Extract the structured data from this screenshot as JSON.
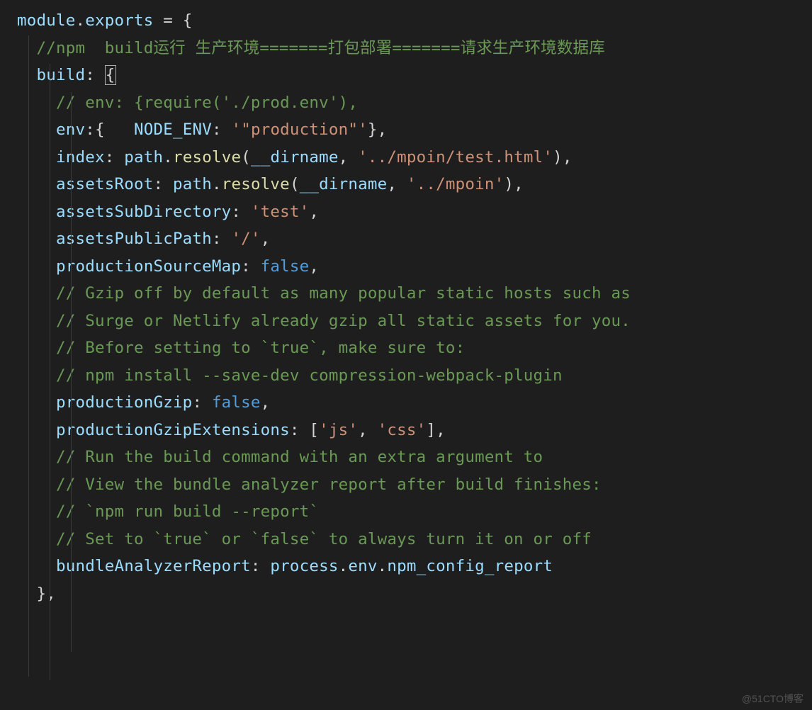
{
  "watermark": "@51CTO博客",
  "code": {
    "l1_module": "module",
    "l1_dot": ".",
    "l1_exports": "exports",
    "l1_eq": " = {",
    "l2_cmt": "  //npm  build运行 生产环境=======打包部署=======请求生产环境数据库",
    "l3_key": "  build",
    "l3_colon": ": ",
    "l3_brace": "{",
    "l4_cmt": "    // env: {require('./prod.env'),",
    "l5_env": "    env",
    "l5_colon": ":{   ",
    "l5_node": "NODE_ENV",
    "l5_colon2": ": ",
    "l5_val": "'\"production\"'",
    "l5_end": "},",
    "l6_k": "    index",
    "l6_c": ": ",
    "l6_path": "path",
    "l6_d": ".",
    "l6_fn": "resolve",
    "l6_o": "(",
    "l6_dir": "__dirname",
    "l6_cm": ", ",
    "l6_s": "'../mpoin/test.html'",
    "l6_cl": "),",
    "l7_k": "    assetsRoot",
    "l7_c": ": ",
    "l7_path": "path",
    "l7_d": ".",
    "l7_fn": "resolve",
    "l7_o": "(",
    "l7_dir": "__dirname",
    "l7_cm": ", ",
    "l7_s": "'../mpoin'",
    "l7_cl": "),",
    "l8_k": "    assetsSubDirectory",
    "l8_c": ": ",
    "l8_s": "'test'",
    "l8_e": ",",
    "l9_k": "    assetsPublicPath",
    "l9_c": ": ",
    "l9_s": "'/'",
    "l9_e": ",",
    "l10_k": "    productionSourceMap",
    "l10_c": ": ",
    "l10_v": "false",
    "l10_e": ",",
    "l11_cmt": "    // Gzip off by default as many popular static hosts such as",
    "l12_cmt": "    // Surge or Netlify already gzip all static assets for you.",
    "l13_cmt": "    // Before setting to `true`, make sure to:",
    "l14_cmt": "    // npm install --save-dev compression-webpack-plugin",
    "l15_k": "    productionGzip",
    "l15_c": ": ",
    "l15_v": "false",
    "l15_e": ",",
    "l16_k": "    productionGzipExtensions",
    "l16_c": ": [",
    "l16_s1": "'js'",
    "l16_cm": ", ",
    "l16_s2": "'css'",
    "l16_e": "],",
    "l17_cmt": "    // Run the build command with an extra argument to",
    "l18_cmt": "    // View the bundle analyzer report after build finishes:",
    "l19_cmt": "    // `npm run build --report`",
    "l20_cmt": "    // Set to `true` or `false` to always turn it on or off",
    "l21_k": "    bundleAnalyzerReport",
    "l21_c": ": ",
    "l21_p1": "process",
    "l21_d1": ".",
    "l21_p2": "env",
    "l21_d2": ".",
    "l21_p3": "npm_config_report",
    "l22": "  },"
  }
}
